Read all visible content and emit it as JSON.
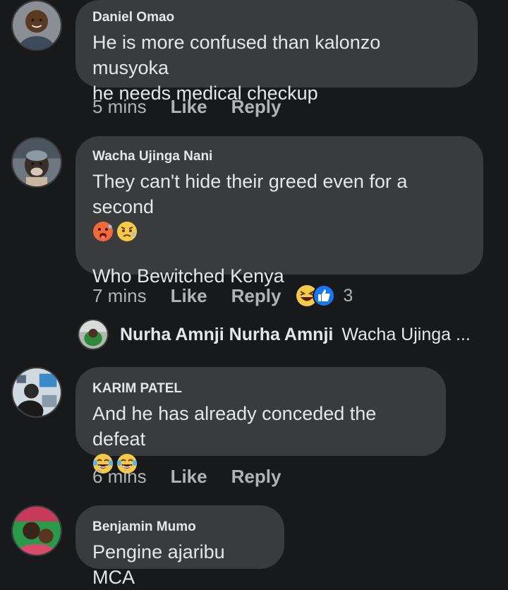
{
  "comments": [
    {
      "author": "Daniel Omao",
      "text_line1": "He is more confused than kalonzo musyoka",
      "text_line2": "he needs medical checkup",
      "time": "5 mins",
      "like": "Like",
      "reply": "Reply"
    },
    {
      "author": "Wacha Ujinga Nani",
      "text_line1": "They can't hide their greed even for a second",
      "emojis": [
        "hot-face-emoji",
        "worried-face-emoji"
      ],
      "text_line2": "Who Bewitched Kenya",
      "time": "7 mins",
      "like": "Like",
      "reply": "Reply",
      "reactions": {
        "icons": [
          "laughing-squint-reaction-icon",
          "like-reaction-icon"
        ],
        "count": "3"
      }
    },
    {
      "author": "KARIM PATEL",
      "text_line1": "And he has already conceded the defeat",
      "emojis": [
        "tears-of-joy-emoji",
        "tears-of-joy-emoji"
      ],
      "time": "6 mins",
      "like": "Like",
      "reply": "Reply"
    },
    {
      "author": "Benjamin Mumo",
      "text_line1": "Pengine ajaribu MCA"
    }
  ],
  "reply_preview": {
    "author": "Nurha Amnji Nurha Amnji",
    "snippet": "Wacha Ujinga ..."
  },
  "colors": {
    "background": "#18191a",
    "bubble": "#3a3b3c",
    "text": "#e4e6eb",
    "muted": "#b0b3b8",
    "like_blue": "#1877f2",
    "emoji_yellow": "#f7c94b"
  }
}
